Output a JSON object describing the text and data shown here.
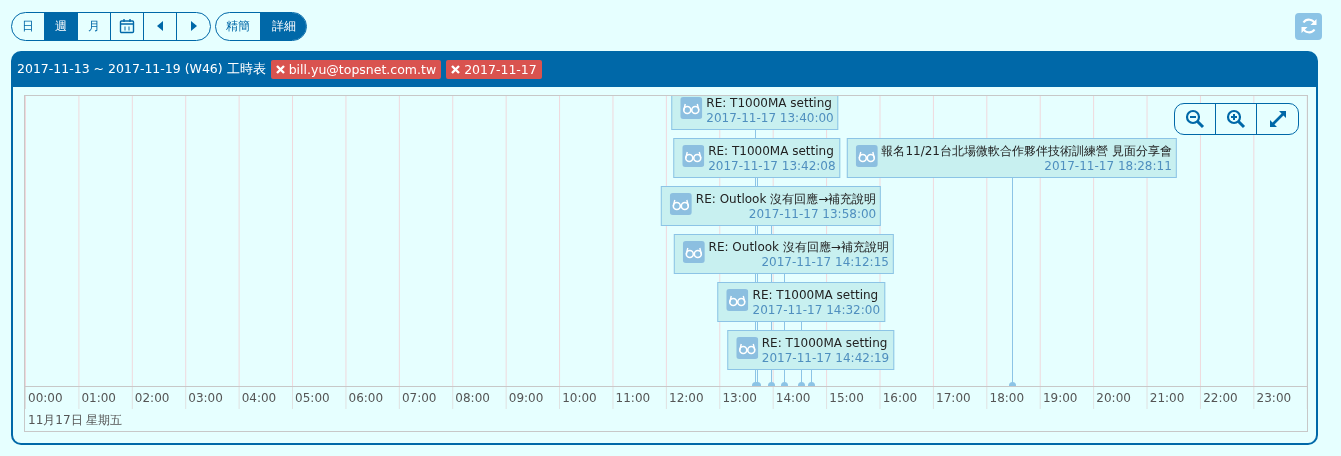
{
  "toolbar": {
    "view_buttons": [
      {
        "label": "日",
        "selected": false
      },
      {
        "label": "週",
        "selected": true
      },
      {
        "label": "月",
        "selected": false
      }
    ],
    "mode_buttons": [
      {
        "label": "精簡",
        "selected": false
      },
      {
        "label": "詳細",
        "selected": true
      }
    ]
  },
  "panel": {
    "title": "2017-11-13 ~ 2017-11-19 (W46) 工時表",
    "filters": [
      {
        "label": "bill.yu@topsnet.com.tw"
      },
      {
        "label": "2017-11-17"
      }
    ]
  },
  "timeline": {
    "lanes": [
      [
        {
          "title": "RE: T1000MA setting",
          "time": "2017-11-17 13:40:00"
        }
      ],
      [
        {
          "title": "RE: T1000MA setting",
          "time": "2017-11-17 13:42:08"
        },
        {
          "title": "報名11/21台北場微軟合作夥伴技術訓練營 見面分享會",
          "time": "2017-11-17 18:28:11"
        }
      ],
      [
        {
          "title": "RE: Outlook 沒有回應→補充說明",
          "time": "2017-11-17 13:58:00"
        }
      ],
      [
        {
          "title": "RE: Outlook 沒有回應→補充說明",
          "time": "2017-11-17 14:12:15"
        }
      ],
      [
        {
          "title": "RE: T1000MA setting",
          "time": "2017-11-17 14:32:00"
        }
      ],
      [
        {
          "title": "RE: T1000MA setting",
          "time": "2017-11-17 14:42:19"
        }
      ]
    ],
    "hours": [
      "00:00",
      "01:00",
      "02:00",
      "03:00",
      "04:00",
      "05:00",
      "06:00",
      "07:00",
      "08:00",
      "09:00",
      "10:00",
      "11:00",
      "12:00",
      "13:00",
      "14:00",
      "15:00",
      "16:00",
      "17:00",
      "18:00",
      "19:00",
      "20:00",
      "21:00",
      "22:00",
      "23:00"
    ],
    "date_label": "11月17日 星期五"
  }
}
